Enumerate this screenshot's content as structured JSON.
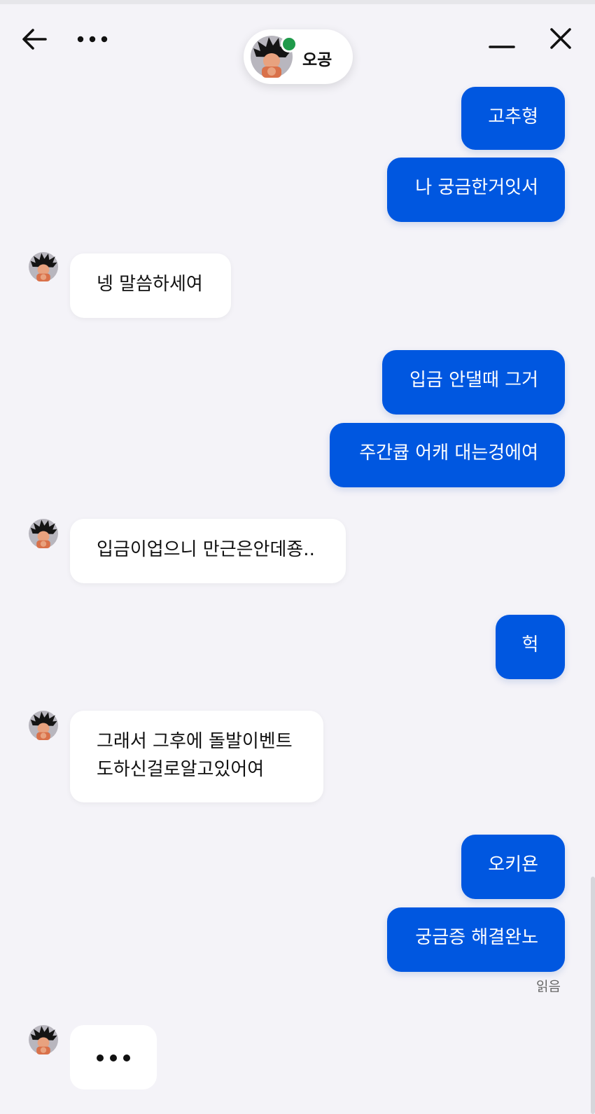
{
  "header": {
    "contact_name": "오공",
    "icons": {
      "back": "arrow-left-icon",
      "more": "ellipsis-icon",
      "minimize": "minimize-icon",
      "close": "close-icon"
    }
  },
  "colors": {
    "outgoing_bubble": "#0057e0",
    "incoming_bubble": "#ffffff",
    "background": "#f4f3f8",
    "online": "#1f9a4a"
  },
  "messages": [
    {
      "from": "me",
      "text": "고추형"
    },
    {
      "from": "me",
      "text": "나 궁금한거잇서"
    },
    {
      "from": "them",
      "text": "넹 말씀하세여"
    },
    {
      "from": "me",
      "text": "입금 안댈때 그거"
    },
    {
      "from": "me",
      "text": "주간큡 어캐 대는겅에여"
    },
    {
      "from": "them",
      "text": "입금이업으니 만근은안데죵.."
    },
    {
      "from": "me",
      "text": "헉"
    },
    {
      "from": "them",
      "text": "그래서 그후에 돌발이벤트\n도하신걸로알고있어여"
    },
    {
      "from": "me",
      "text": "오키욘"
    },
    {
      "from": "me",
      "text": "궁금증 해결완노"
    }
  ],
  "read_receipt": "읽음",
  "typing_indicator": true
}
